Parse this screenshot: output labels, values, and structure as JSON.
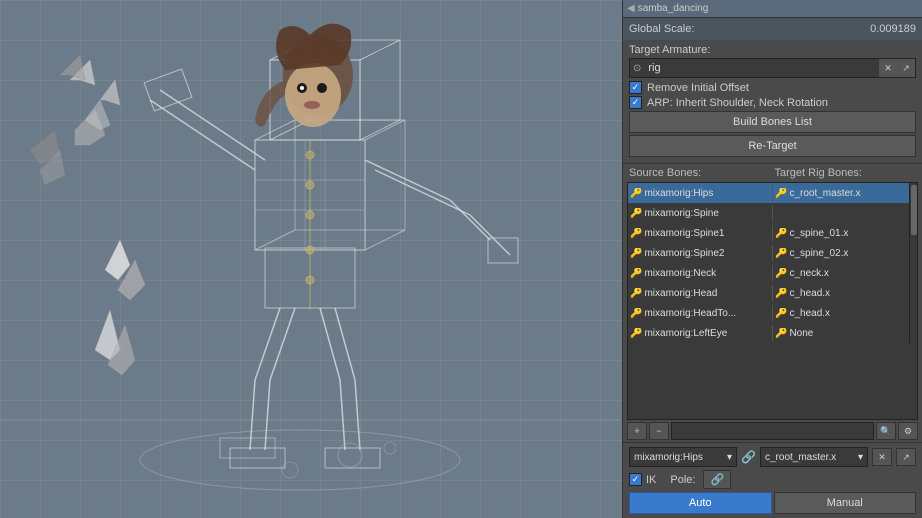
{
  "viewport": {
    "background_color": "#6b7b8a"
  },
  "top_strip": {
    "icon": "◀",
    "text": "samba_dancing"
  },
  "right_panel": {
    "global_scale_label": "Global Scale:",
    "global_scale_value": "0.009189",
    "target_armature_label": "Target Armature:",
    "rig_value": "rig",
    "remove_initial_offset_label": "Remove Initial Offset",
    "arp_inherit_label": "ARP: Inherit Shoulder, Neck Rotation",
    "build_bones_label": "Build Bones List",
    "retarget_label": "Re-Target",
    "source_bones_label": "Source Bones:",
    "target_rig_bones_label": "Target Rig Bones:",
    "bones": [
      {
        "source": "mixamorig:Hips",
        "target": "c_root_master.x",
        "selected": true
      },
      {
        "source": "mixamorig:Spine",
        "target": "",
        "selected": false
      },
      {
        "source": "mixamorig:Spine1",
        "target": "c_spine_01.x",
        "selected": false
      },
      {
        "source": "mixamorig:Spine2",
        "target": "c_spine_02.x",
        "selected": false
      },
      {
        "source": "mixamorig:Neck",
        "target": "c_neck.x",
        "selected": false
      },
      {
        "source": "mixamorig:Head",
        "target": "c_head.x",
        "selected": false
      },
      {
        "source": "mixamorig:HeadTo...",
        "target": "c_head.x",
        "selected": false
      },
      {
        "source": "mixamorig:LeftEye",
        "target": "None",
        "selected": false
      }
    ],
    "bottom_source": "mixamorig:Hips",
    "bottom_target": "c_root_master.x",
    "ik_label": "IK",
    "pole_label": "Pole:",
    "auto_label": "Auto",
    "manual_label": "Manual"
  }
}
